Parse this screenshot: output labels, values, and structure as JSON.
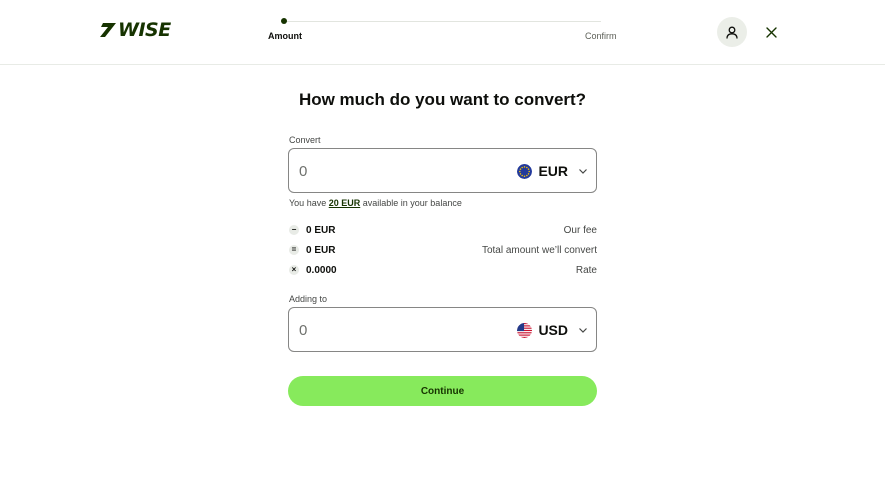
{
  "header": {
    "logo_text": "WISE",
    "steps": [
      {
        "label": "Amount",
        "active": true
      },
      {
        "label": "Confirm",
        "active": false
      }
    ],
    "account_icon": "user-icon",
    "close_icon": "close-icon"
  },
  "main": {
    "title": "How much do you want to convert?",
    "convert": {
      "label": "Convert",
      "placeholder": "0",
      "currency": "EUR",
      "currency_icon": "eu-flag-icon"
    },
    "balance": {
      "prefix": "You have",
      "amount": "20 EUR",
      "suffix": "available in your balance"
    },
    "summary": [
      {
        "operator": "−",
        "value": "0 EUR",
        "label": "Our fee"
      },
      {
        "operator": "=",
        "value": "0 EUR",
        "label": "Total amount we’ll convert"
      },
      {
        "operator": "×",
        "value": "0.0000",
        "label": "Rate"
      }
    ],
    "adding": {
      "label": "Adding to",
      "placeholder": "0",
      "currency": "USD",
      "currency_icon": "us-flag-icon"
    },
    "continue_label": "Continue"
  },
  "colors": {
    "brand_dark": "#163300",
    "brand_green": "#87ea5c",
    "border": "#868685"
  }
}
